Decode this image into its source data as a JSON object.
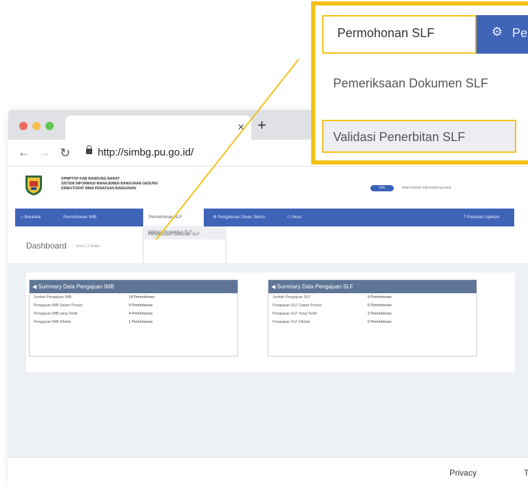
{
  "browser": {
    "url": "http://simbg.pu.go.id/",
    "close_glyph": "×",
    "new_tab_glyph": "+"
  },
  "site": {
    "org_lines": [
      "DPMPTSP KAB BANDUNG BARAT",
      "SISTEM INFORMASI MANAJEMEN BANGUNAN GEDUNG",
      "DIREKTORAT BINA PENATAAN BANGUNAN"
    ],
    "info_badge": "Info",
    "user_email": "kirana.lestari.sdb.bandung.barat"
  },
  "nav": {
    "items": [
      "Beranda",
      "Permohonan IMB",
      "Permohonan SLF",
      "Pengaturan Dinas Teknis",
      "Akun"
    ],
    "help": "Panduan Aplikasi"
  },
  "dropdown": {
    "item1": "Pemeriksaan Dokumen SLF",
    "item2": "Validasi Penerbitan SLF"
  },
  "dashboard": {
    "title": "Dashboard",
    "subtitle": "Versi 1.3 Stable"
  },
  "panel_imb": {
    "title": "Summary Data Pengajuan IMB",
    "rows": [
      {
        "label": "Jumlah Pengajuan IMB",
        "value": "14 Permohonan"
      },
      {
        "label": "Pengajuan IMB Dalam Proses",
        "value": "9 Permohonan"
      },
      {
        "label": "Pengajuan IMB yang Terbit",
        "value": "4 Permohonan"
      },
      {
        "label": "Pengajuan IMB Ditolak",
        "value": "1 Permohonan"
      }
    ]
  },
  "panel_slf": {
    "title": "Summary Data Pengajuan SLF",
    "rows": [
      {
        "label": "Jumlah Pengajuan SLF",
        "value": "9 Permohonan"
      },
      {
        "label": "Pengajuan SLF Dalam Proses",
        "value": "6 Permohonan"
      },
      {
        "label": "Pengajuan SLF Yang Terbit",
        "value": "3 Permohonan"
      },
      {
        "label": "Pengajuan SLF Ditolak",
        "value": "0 Permohonan"
      }
    ]
  },
  "footer": {
    "privacy": "Privacy",
    "trailing": "T"
  },
  "zoom": {
    "menu_label": "Permohonan SLF",
    "blue_text": "Pe",
    "item1": "Pemeriksaan Dokumen SLF",
    "item2": "Validasi Penerbitan SLF"
  },
  "colors": {
    "accent": "#f3c117",
    "nav_blue": "#3f63b7",
    "panel_header": "#5e7596"
  }
}
